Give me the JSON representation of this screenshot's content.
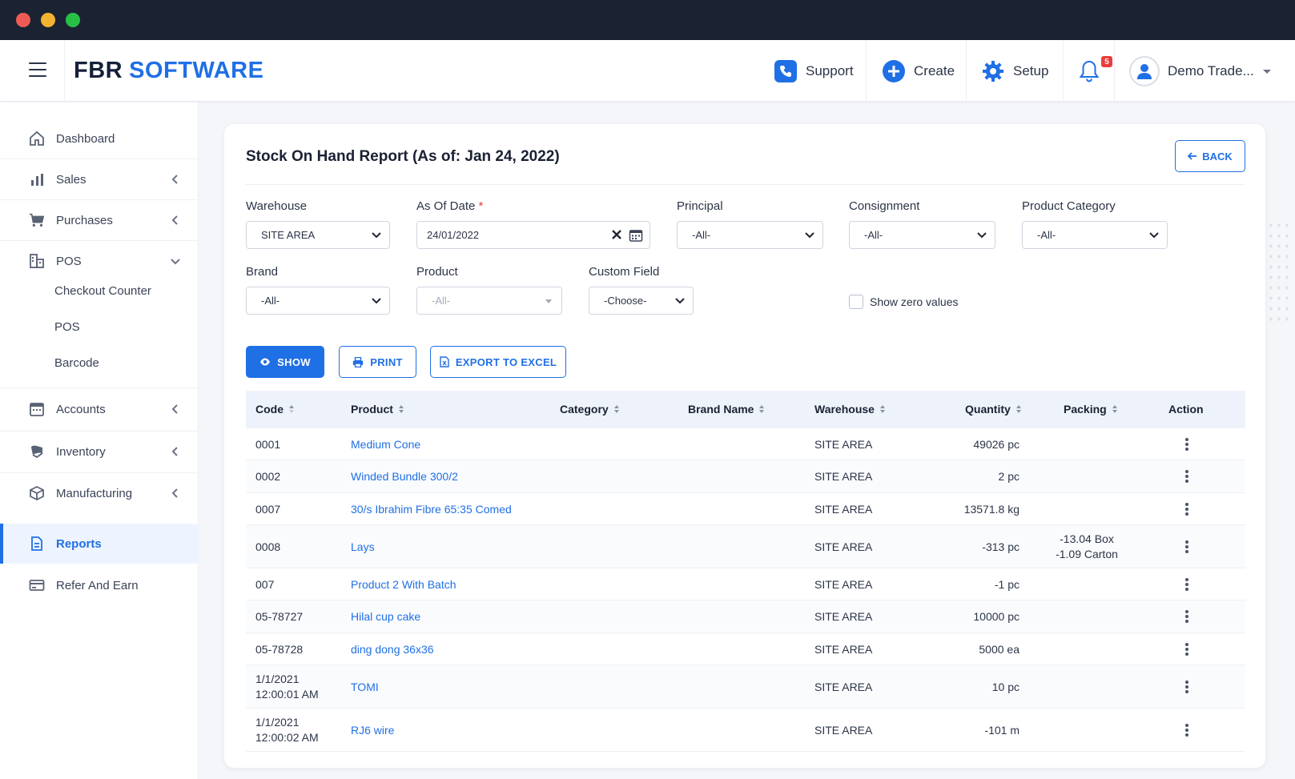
{
  "app": {
    "brand_part1": "FBR",
    "brand_part2": "SOFTWARE"
  },
  "topnav": {
    "support_label": "Support",
    "create_label": "Create",
    "setup_label": "Setup",
    "notification_count": "5",
    "user_name": "Demo Trade..."
  },
  "sidebar": {
    "items": [
      {
        "label": "Dashboard",
        "icon": "home-icon"
      },
      {
        "label": "Sales",
        "icon": "bar-chart-icon"
      },
      {
        "label": "Purchases",
        "icon": "cart-icon"
      },
      {
        "label": "POS",
        "icon": "building-icon"
      },
      {
        "label": "Accounts",
        "icon": "calendar-icon"
      },
      {
        "label": "Inventory",
        "icon": "inventory-icon"
      },
      {
        "label": "Manufacturing",
        "icon": "box-icon"
      },
      {
        "label": "Reports",
        "icon": "document-icon"
      },
      {
        "label": "Refer And Earn",
        "icon": "card-icon"
      }
    ],
    "pos_subitems": [
      "Checkout Counter",
      "POS",
      "Barcode"
    ],
    "active": "Reports"
  },
  "report": {
    "title": "Stock On Hand Report (As of: Jan 24, 2022)",
    "back_label": "BACK"
  },
  "filters": {
    "warehouse": {
      "label": "Warehouse",
      "value": "SITE AREA"
    },
    "as_of_date": {
      "label": "As Of Date",
      "required_mark": "*",
      "value": "24/01/2022"
    },
    "principal": {
      "label": "Principal",
      "value": "-All-"
    },
    "consignment": {
      "label": "Consignment",
      "value": "-All-"
    },
    "product_category": {
      "label": "Product Category",
      "value": "-All-"
    },
    "brand": {
      "label": "Brand",
      "value": "-All-"
    },
    "product": {
      "label": "Product",
      "value": "-All-"
    },
    "custom_field": {
      "label": "Custom Field",
      "value": "-Choose-"
    },
    "show_zero_values": {
      "label": "Show zero values",
      "checked": false
    }
  },
  "actions": {
    "show_label": "SHOW",
    "print_label": "PRINT",
    "export_label": "EXPORT TO EXCEL"
  },
  "table": {
    "headers": {
      "code": "Code",
      "product": "Product",
      "category": "Category",
      "brand_name": "Brand Name",
      "warehouse": "Warehouse",
      "quantity": "Quantity",
      "packing": "Packing",
      "action": "Action"
    },
    "rows": [
      {
        "code": "0001",
        "code2": "",
        "product": "Medium Cone",
        "warehouse": "SITE AREA",
        "quantity": "49026 pc",
        "packing1": "",
        "packing2": ""
      },
      {
        "code": "0002",
        "code2": "",
        "product": "Winded Bundle 300/2",
        "warehouse": "SITE AREA",
        "quantity": "2 pc",
        "packing1": "",
        "packing2": ""
      },
      {
        "code": "0007",
        "code2": "",
        "product": "30/s Ibrahim Fibre 65:35 Comed",
        "warehouse": "SITE AREA",
        "quantity": "13571.8 kg",
        "packing1": "",
        "packing2": ""
      },
      {
        "code": "0008",
        "code2": "",
        "product": "Lays",
        "warehouse": "SITE AREA",
        "quantity": "-313 pc",
        "packing1": "-13.04 Box",
        "packing2": "-1.09 Carton"
      },
      {
        "code": "007",
        "code2": "",
        "product": "Product 2 With Batch",
        "warehouse": "SITE AREA",
        "quantity": "-1 pc",
        "packing1": "",
        "packing2": ""
      },
      {
        "code": "05-78727",
        "code2": "",
        "product": "Hilal cup cake",
        "warehouse": "SITE AREA",
        "quantity": "10000 pc",
        "packing1": "",
        "packing2": ""
      },
      {
        "code": "05-78728",
        "code2": "",
        "product": "ding dong 36x36",
        "warehouse": "SITE AREA",
        "quantity": "5000 ea",
        "packing1": "",
        "packing2": ""
      },
      {
        "code": "1/1/2021",
        "code2": "12:00:01 AM",
        "product": "TOMI",
        "warehouse": "SITE AREA",
        "quantity": "10 pc",
        "packing1": "",
        "packing2": ""
      },
      {
        "code": "1/1/2021",
        "code2": "12:00:02 AM",
        "product": "RJ6 wire",
        "warehouse": "SITE AREA",
        "quantity": "-101 m",
        "packing1": "",
        "packing2": ""
      }
    ]
  },
  "colors": {
    "accent": "#1f6fe5",
    "window_bar": "#1b2333",
    "badge": "#ea3d3d"
  }
}
